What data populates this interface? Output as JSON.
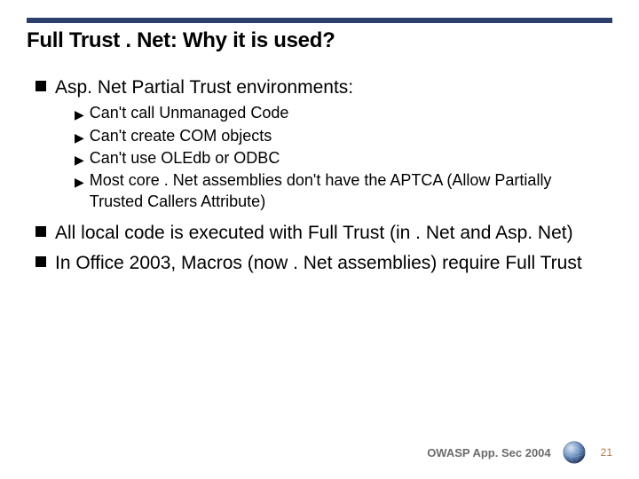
{
  "title": "Full Trust . Net: Why it is used?",
  "bullets": [
    {
      "text": "Asp. Net Partial Trust environments:",
      "sub": [
        "Can't call Unmanaged Code",
        "Can't create COM objects",
        "Can't use OLEdb or ODBC",
        "Most core . Net assemblies don't have the APTCA (Allow Partially Trusted Callers Attribute)"
      ]
    },
    {
      "text": "All local code is executed with Full Trust (in . Net and Asp. Net)",
      "sub": []
    },
    {
      "text": "In Office 2003, Macros (now . Net assemblies) require Full Trust",
      "sub": []
    }
  ],
  "footer": "OWASP App. Sec 2004",
  "page_number": "21"
}
